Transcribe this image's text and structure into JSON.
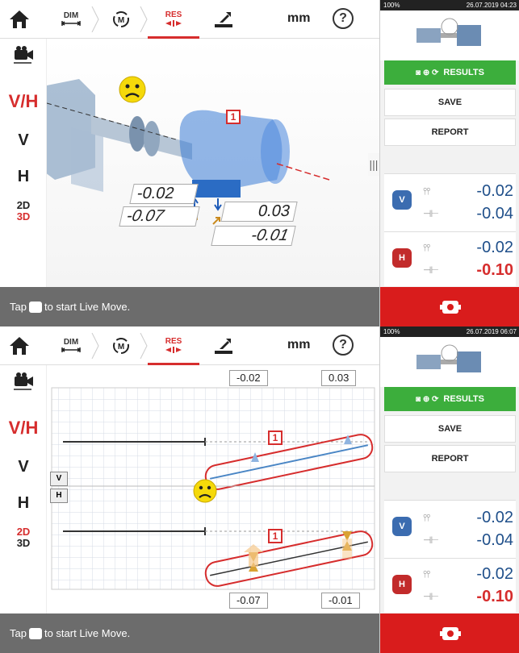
{
  "toolbar": {
    "dim_label": "DIM",
    "m_label": "M",
    "res_label": "RES",
    "units": "mm",
    "help_label": "?"
  },
  "sidebar": {
    "vh": "V/H",
    "v": "V",
    "h": "H",
    "d2": "2D",
    "d3": "3D"
  },
  "status": {
    "prefix": "Tap",
    "suffix": "to start Live Move."
  },
  "panel1": {
    "phone_battery": "100%",
    "phone_time": "26.07.2019 04:23",
    "machine_label": "1",
    "val_top_left": "-0.02",
    "val_top_right": "0.03",
    "val_bottom_left": "-0.07",
    "val_bottom_right": "-0.01"
  },
  "panel2": {
    "phone_battery": "100%",
    "phone_time": "26.07.2019 06:07",
    "machine_label": "1",
    "top_left_value": "-0.02",
    "top_right_value": "0.03",
    "bottom_left_value": "-0.07",
    "bottom_right_value": "-0.01",
    "v_tag": "V",
    "h_tag": "H"
  },
  "results": {
    "results_label": "RESULTS",
    "save_label": "SAVE",
    "report_label": "REPORT",
    "v_badge": "V",
    "h_badge": "H",
    "v_angle": "-0.02",
    "v_offset": "-0.04",
    "h_angle": "-0.02",
    "h_offset": "-0.10"
  },
  "colors": {
    "accent_red": "#d62d2d",
    "results_green": "#3cae3c",
    "value_blue": "#1f4f8a",
    "status_gray": "#6c6c6c",
    "live_red": "#d91c1c"
  }
}
